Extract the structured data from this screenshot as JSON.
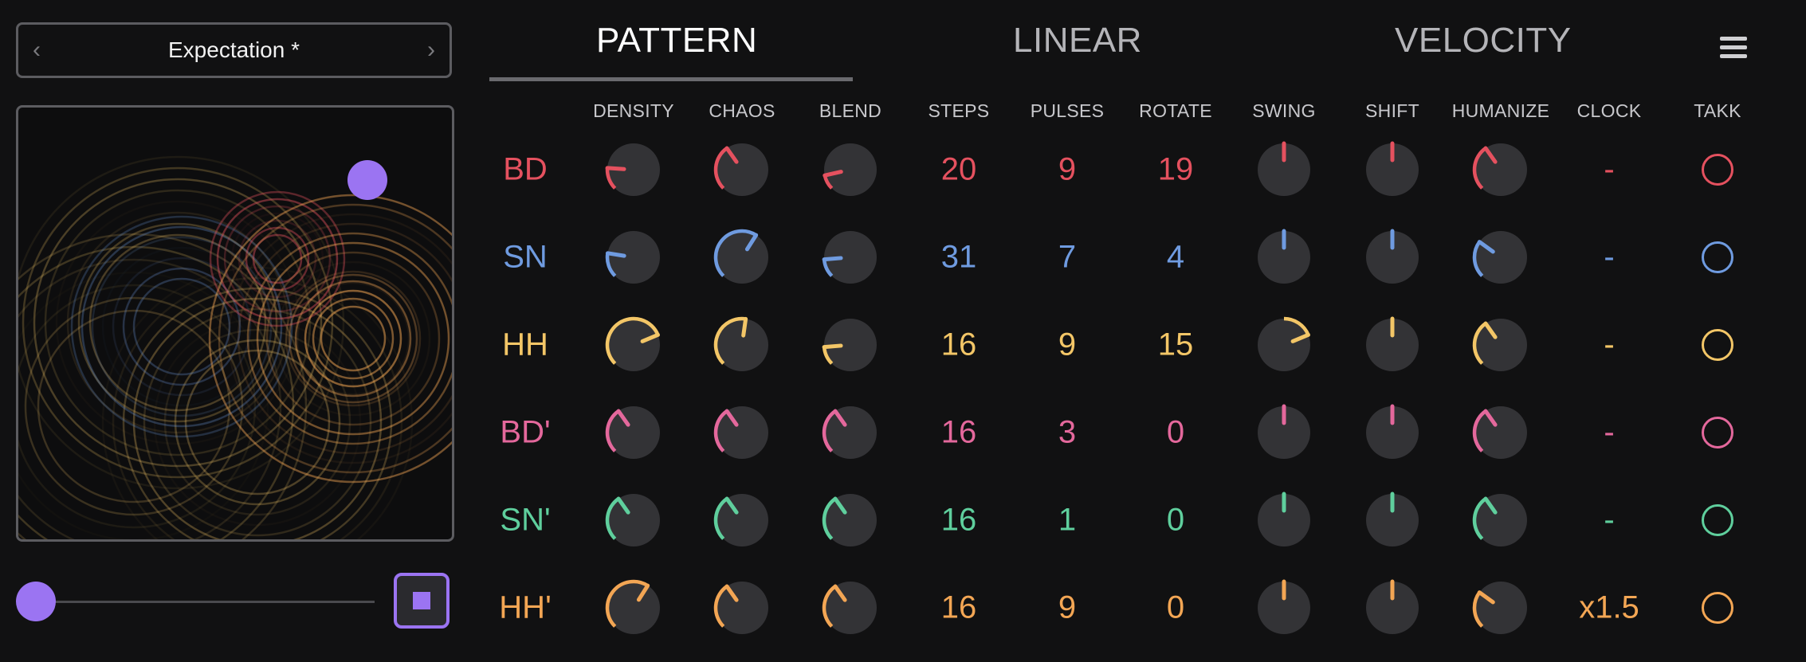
{
  "preset": {
    "name": "Expectation *",
    "prev_icon": "chevron-left-icon",
    "next_icon": "chevron-right-icon"
  },
  "tabs": [
    {
      "label": "PATTERN",
      "active": true
    },
    {
      "label": "LINEAR",
      "active": false
    },
    {
      "label": "VELOCITY",
      "active": false
    }
  ],
  "menu_icon": "hamburger-menu-icon",
  "transport": {
    "slider_value": 0,
    "stop_icon": "stop-icon"
  },
  "accent": "#9b74f2",
  "columns": [
    "DENSITY",
    "CHAOS",
    "BLEND",
    "STEPS",
    "PULSES",
    "ROTATE",
    "SWING",
    "SHIFT",
    "HUMANIZE",
    "CLOCK",
    "TAKK"
  ],
  "rows": [
    {
      "label": "BD",
      "color": "#e5515f",
      "density": 0.18,
      "chaos": 0.37,
      "blend": 0.12,
      "steps": "20",
      "pulses": "9",
      "rotate": "19",
      "swing": 0.5,
      "shift": 0.5,
      "humanize": 0.37,
      "clock": "-"
    },
    {
      "label": "SN",
      "color": "#6f9be0",
      "density": 0.2,
      "chaos": 0.62,
      "blend": 0.15,
      "steps": "31",
      "pulses": "7",
      "rotate": "4",
      "swing": 0.5,
      "shift": 0.5,
      "humanize": 0.3,
      "clock": "-"
    },
    {
      "label": "HH",
      "color": "#f3c667",
      "density": 0.75,
      "chaos": 0.53,
      "blend": 0.15,
      "steps": "16",
      "pulses": "9",
      "rotate": "15",
      "swing": 0.75,
      "shift": 0.5,
      "humanize": 0.37,
      "clock": "-"
    },
    {
      "label": "BD'",
      "color": "#e4689c",
      "density": 0.37,
      "chaos": 0.37,
      "blend": 0.37,
      "steps": "16",
      "pulses": "3",
      "rotate": "0",
      "swing": 0.5,
      "shift": 0.5,
      "humanize": 0.37,
      "clock": "-"
    },
    {
      "label": "SN'",
      "color": "#5fcf9d",
      "density": 0.37,
      "chaos": 0.37,
      "blend": 0.37,
      "steps": "16",
      "pulses": "1",
      "rotate": "0",
      "swing": 0.5,
      "shift": 0.5,
      "humanize": 0.37,
      "clock": "-"
    },
    {
      "label": "HH'",
      "color": "#f3a654",
      "density": 0.62,
      "chaos": 0.37,
      "blend": 0.37,
      "steps": "16",
      "pulses": "9",
      "rotate": "0",
      "swing": 0.5,
      "shift": 0.5,
      "humanize": 0.3,
      "clock": "x1.5"
    }
  ]
}
